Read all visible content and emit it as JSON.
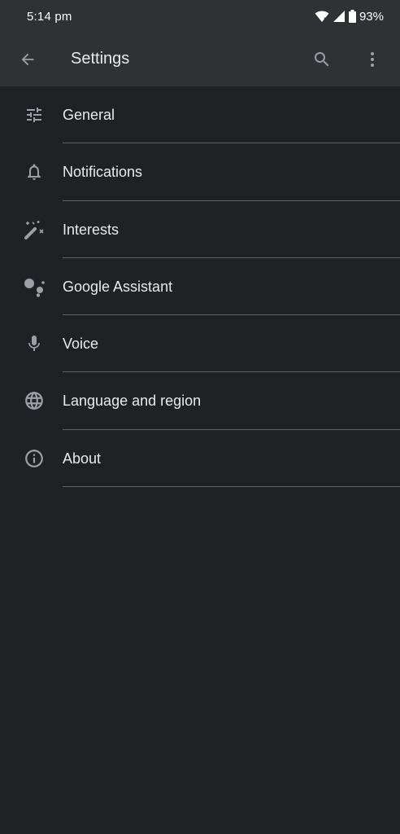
{
  "status_bar": {
    "time": "5:14 pm",
    "battery": "93%"
  },
  "app_bar": {
    "title": "Settings"
  },
  "settings_items": [
    {
      "label": "General",
      "icon": "tune-icon"
    },
    {
      "label": "Notifications",
      "icon": "bell-icon"
    },
    {
      "label": "Interests",
      "icon": "magic-wand-icon"
    },
    {
      "label": "Google Assistant",
      "icon": "assistant-icon"
    },
    {
      "label": "Voice",
      "icon": "microphone-icon"
    },
    {
      "label": "Language and region",
      "icon": "globe-icon"
    },
    {
      "label": "About",
      "icon": "info-icon"
    }
  ],
  "colors": {
    "background": "#202124",
    "app_bar": "#303134",
    "icon": "#9aa0a6",
    "text": "#e8eaed",
    "divider": "#5f6368"
  }
}
